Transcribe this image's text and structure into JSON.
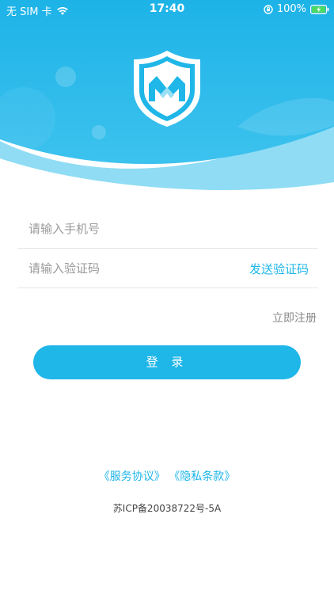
{
  "status_bar": {
    "carrier": "无 SIM 卡",
    "time": "17:40",
    "battery": "100%",
    "icons": [
      "wifi-icon",
      "orientation-lock-icon",
      "battery-charging-icon"
    ]
  },
  "colors": {
    "primary": "#1fb6e8",
    "header_light": "#7fd6f2",
    "text_muted": "#9a9a9a"
  },
  "logo": {
    "icon": "shield-logo-icon"
  },
  "form": {
    "phone_placeholder": "请输入手机号",
    "code_placeholder": "请输入验证码",
    "send_code_label": "发送验证码",
    "register_label": "立即注册",
    "login_label": "登 录"
  },
  "footer": {
    "service_agreement": "《服务协议》",
    "privacy_policy": "《隐私条款》",
    "icp": "苏ICP备20038722号-5A"
  }
}
